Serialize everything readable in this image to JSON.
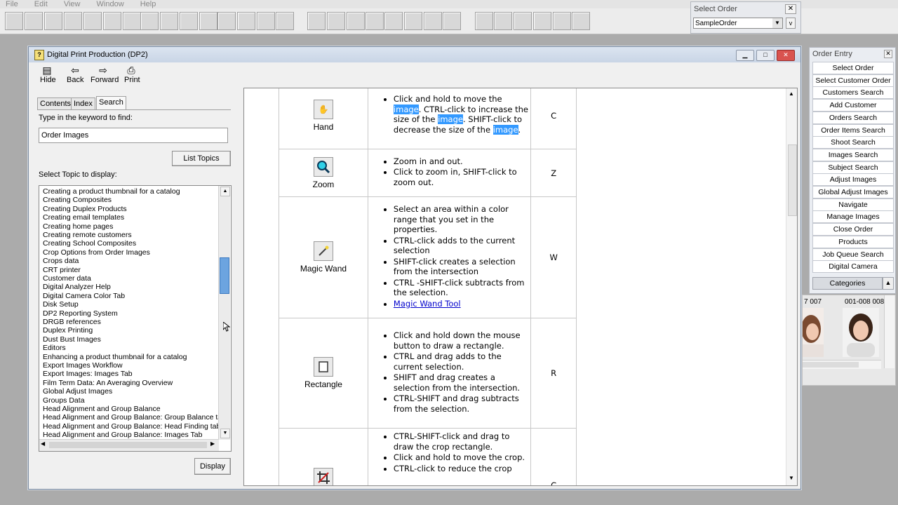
{
  "menu": [
    "File",
    "Edit",
    "View",
    "Window",
    "Help"
  ],
  "select_order": {
    "title": "Select Order",
    "value": "SampleOrder",
    "close": "✕",
    "v_label": "v"
  },
  "help_window": {
    "title": "Digital Print Production (DP2)",
    "toolbar": [
      {
        "label": "Hide",
        "icon": "hide-icon"
      },
      {
        "label": "Back",
        "icon": "back-arrow-icon"
      },
      {
        "label": "Forward",
        "icon": "forward-arrow-icon"
      },
      {
        "label": "Print",
        "icon": "printer-icon"
      }
    ],
    "tabs": [
      "Contents",
      "Index",
      "Search"
    ],
    "keyword_label": "Type in the keyword to find:",
    "keyword_value": "Order Images",
    "list_topics_label": "List Topics",
    "topic_label": "Select Topic to display:",
    "display_label": "Display",
    "topics": [
      "Creating a product thumbnail for a catalog",
      "Creating Composites",
      "Creating Duplex Products",
      "Creating email templates",
      "Creating home pages",
      "Creating remote customers",
      "Creating School Composites",
      "Crop Options from Order Images",
      "Crops data",
      "CRT printer",
      "Customer data",
      "Digital Analyzer Help",
      "Digital Camera Color Tab",
      "Disk Setup",
      "DP2 Reporting System",
      "DRGB references",
      "Duplex Printing",
      "Dust Bust Images",
      "Editors",
      "Enhancing a product thumbnail for a catalog",
      "Export Images Workflow",
      "Export Images: Images Tab",
      "Film Term Data: An Averaging Overview",
      "Global Adjust Images",
      "Groups Data",
      "Head Alignment and Group Balance",
      "Head Alignment and Group Balance: Group Balance tab",
      "Head Alignment and Group Balance: Head Finding tab",
      "Head Alignment and Group Balance: Images Tab"
    ],
    "tools": [
      {
        "name": "Hand",
        "key": "C"
      },
      {
        "name": "Zoom",
        "key": "Z",
        "bullets": [
          "Zoom in and out.",
          "Click to zoom in, SHIFT-click to zoom out."
        ]
      },
      {
        "name": "Magic Wand",
        "key": "W",
        "bullets": [
          "Select an area within a color range that you set in the properties.",
          "CTRL-click adds to the current selection",
          "SHIFT-click creates a selection from the intersection",
          "CTRL -SHIFT-click subtracts from the selection."
        ],
        "link": "Magic Wand Tool"
      },
      {
        "name": "Rectangle",
        "key": "R",
        "bullets": [
          "Click and hold down the mouse button to draw a rectangle.",
          "CTRL and drag adds to the current selection.",
          "SHIFT and drag creates a selection from the intersection.",
          "CTRL-SHIFT and drag subtracts from the selection."
        ]
      },
      {
        "name": "",
        "key": "C",
        "bullets": [
          "CTRL-SHIFT-click and drag to draw the crop rectangle.",
          "Click and hold to move the crop.",
          "CTRL-click to reduce the crop"
        ]
      }
    ],
    "hand_text": {
      "t1": "Click and hold to move the ",
      "h1": "image",
      "t2": ". CTRL-click to increase the size of the ",
      "h2": "image",
      "t3": ". SHIFT-click to decrease the size of the ",
      "h3": "image",
      "t4": "."
    }
  },
  "order_entry": {
    "title": "Order Entry",
    "buttons": [
      "Select Order",
      "Select Customer Order",
      "Customers Search",
      "Add Customer",
      "Orders Search",
      "Order Items Search",
      "Shoot Search",
      "Images Search",
      "Subject Search",
      "Adjust Images",
      "Global Adjust Images",
      "Navigate",
      "Manage Images",
      "Close Order",
      "Products",
      "Job Queue Search",
      "Digital Camera"
    ],
    "categories": "Categories"
  },
  "thumbnails": {
    "label1": "7  007",
    "label2": "001-008  008"
  }
}
